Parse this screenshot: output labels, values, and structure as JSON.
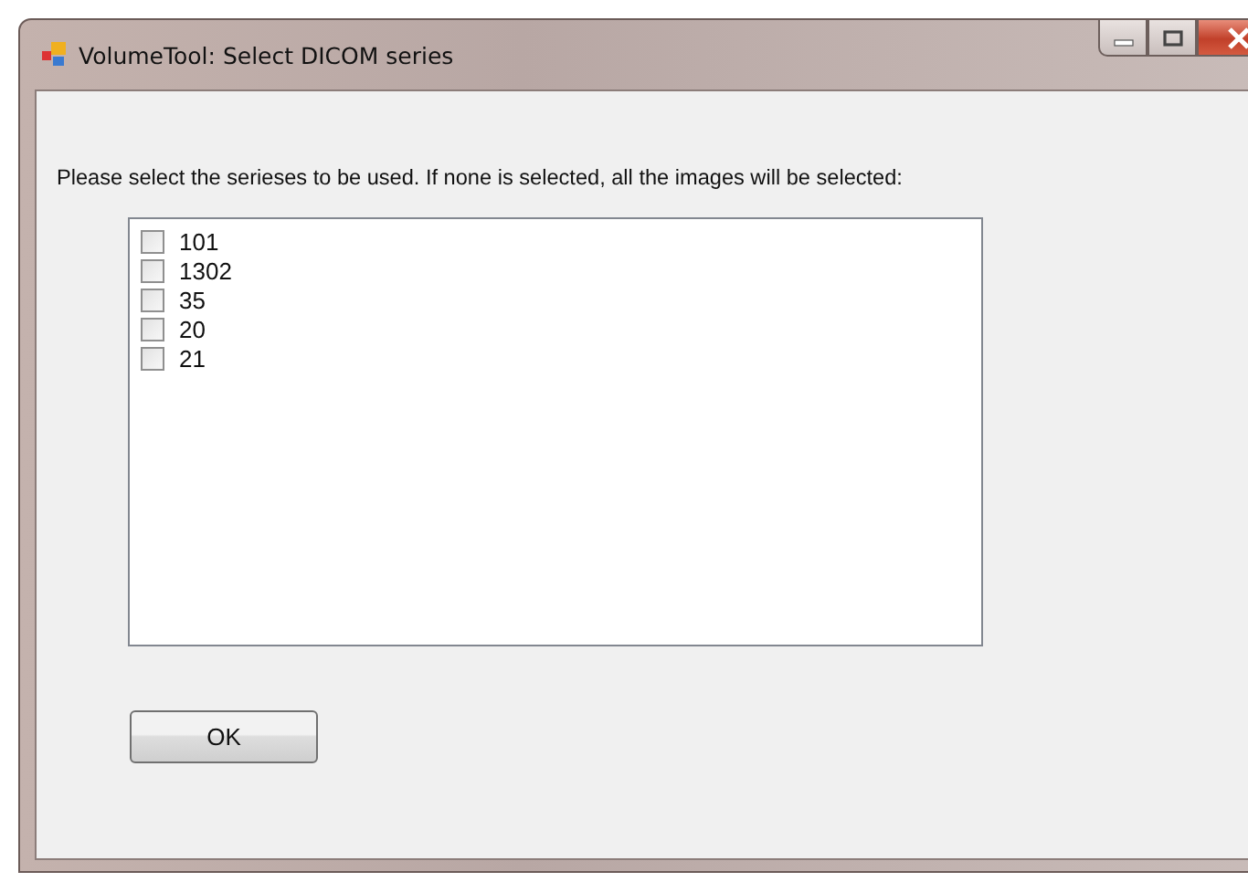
{
  "window": {
    "title": "VolumeTool: Select DICOM series"
  },
  "instruction": "Please select the serieses to be used. If none is selected, all the images will be selected:",
  "series": [
    {
      "label": "101",
      "checked": false
    },
    {
      "label": "1302",
      "checked": false
    },
    {
      "label": "35",
      "checked": false
    },
    {
      "label": "20",
      "checked": false
    },
    {
      "label": "21",
      "checked": false
    }
  ],
  "buttons": [
    "OK"
  ]
}
